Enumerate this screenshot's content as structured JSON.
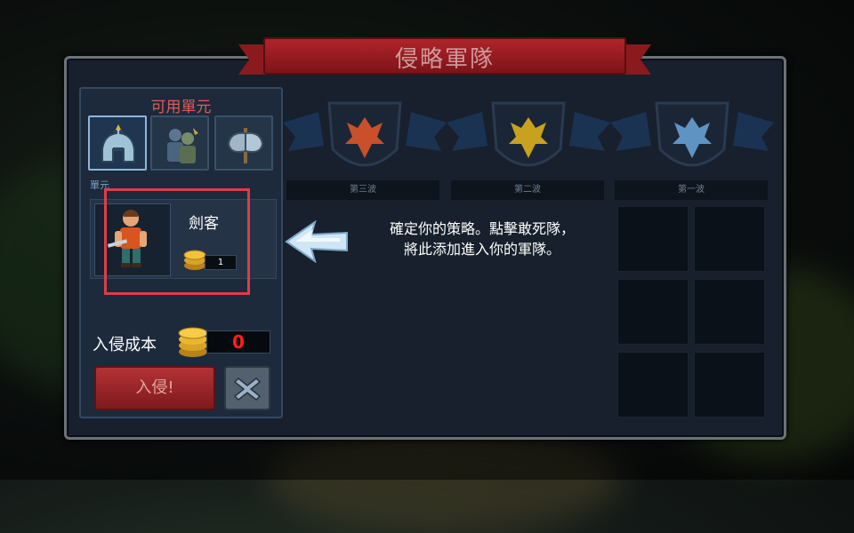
{
  "title": "侵略軍隊",
  "left_panel": {
    "title": "可用單元",
    "tabs": [
      {
        "icon": "helmet-icon",
        "active": true
      },
      {
        "icon": "troops-icon",
        "active": false
      },
      {
        "icon": "axe-icon",
        "active": false
      }
    ],
    "section_label": "單元",
    "unit": {
      "name": "劍客",
      "cost": "1",
      "icon": "swordsman-icon"
    },
    "cost_label": "入侵成本",
    "cost_value": "0",
    "invade_button": "入侵!",
    "close_icon": "close-x-icon"
  },
  "waves": [
    {
      "label": "第三波",
      "color": "#c9502b"
    },
    {
      "label": "第二波",
      "color": "#c8a21e"
    },
    {
      "label": "第一波",
      "color": "#5f93c2"
    }
  ],
  "hint": {
    "line1": "確定你的策略。點擊敢死隊，",
    "line2": "將此添加進入你的軍隊。"
  },
  "colors": {
    "banner": "#9a1e23",
    "highlight": "#e03c45",
    "cost_text": "#ff1e1e"
  }
}
